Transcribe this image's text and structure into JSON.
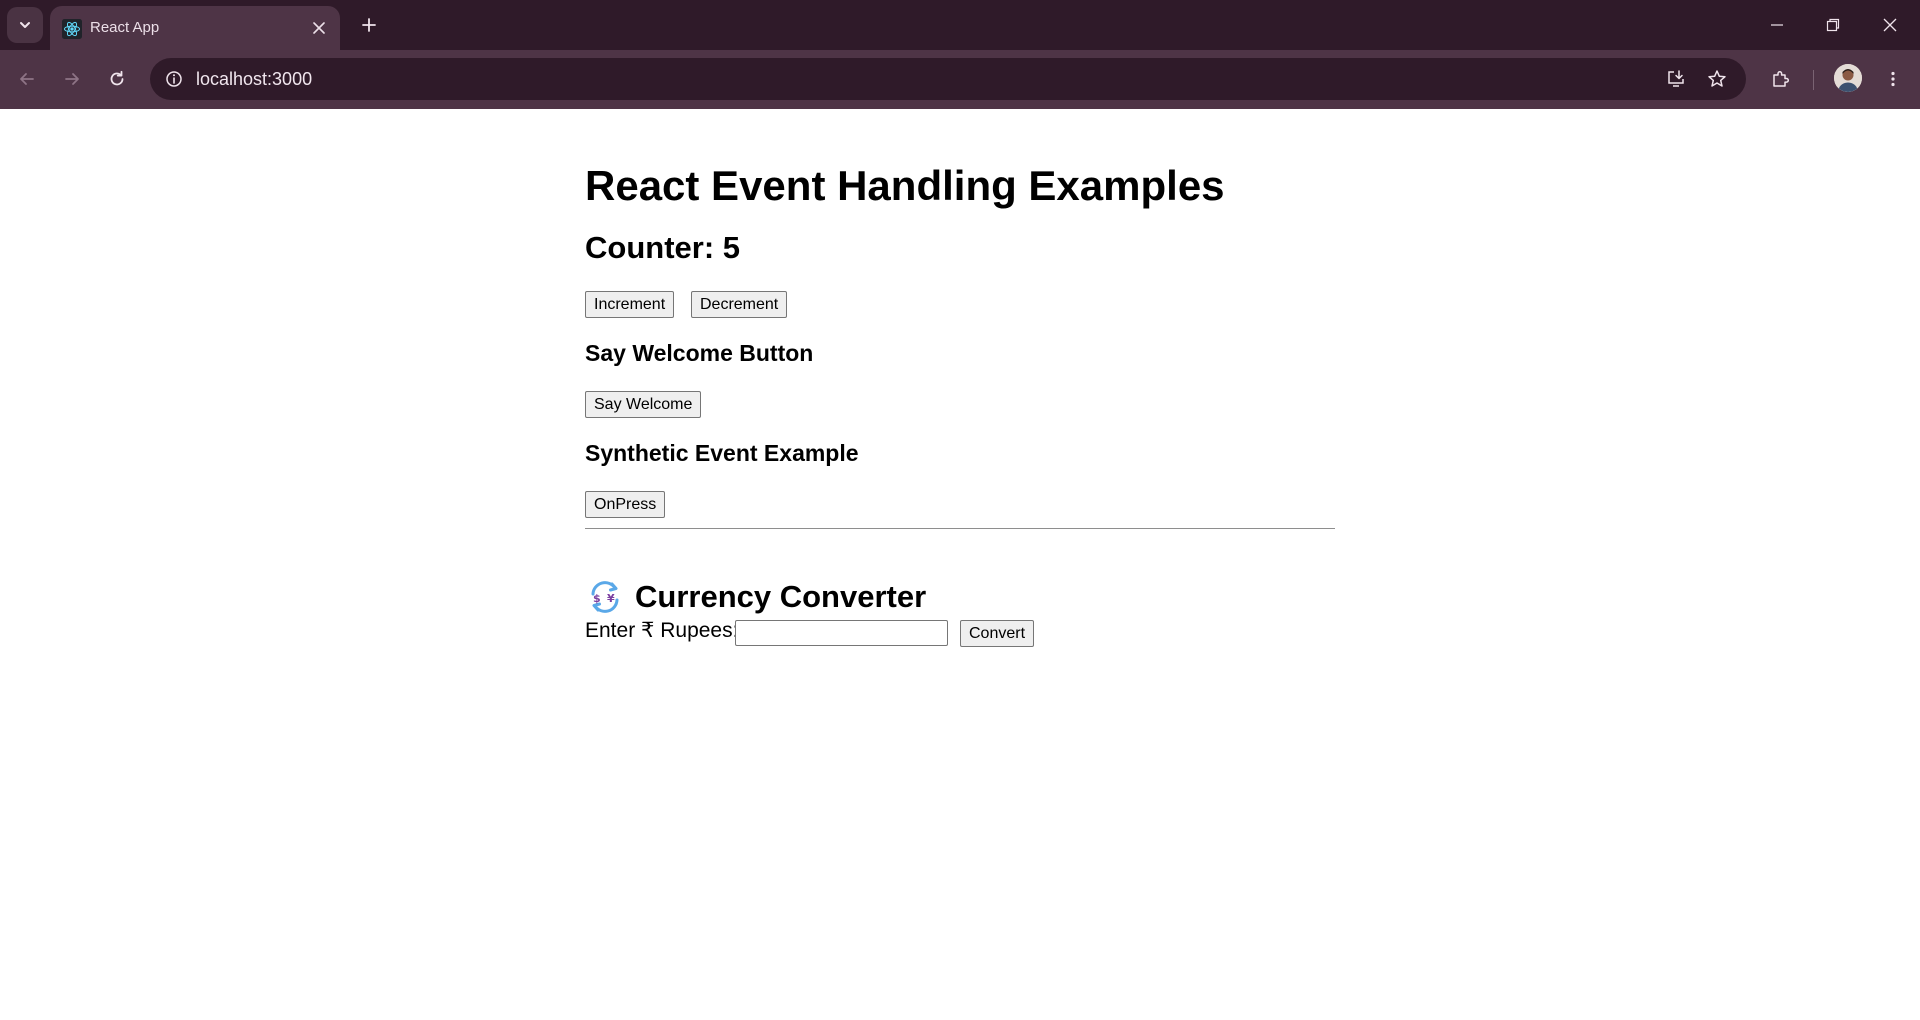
{
  "browser": {
    "tab_title": "React App",
    "url": "localhost:3000",
    "colors": {
      "tabbar_bg": "#2f1a29",
      "toolbar_bg": "#4e3446",
      "omnibox_bg": "#2f1a29"
    },
    "icons": {
      "tab_search": "chevron-down-icon",
      "favicon": "react-logo-icon",
      "tab_close": "close-icon",
      "new_tab": "plus-icon",
      "minimize": "minimize-icon",
      "restore": "restore-icon",
      "close_window": "close-icon",
      "back": "arrow-left-icon",
      "forward": "arrow-right-icon",
      "reload": "reload-icon",
      "site_info": "info-icon",
      "install": "install-app-icon",
      "bookmark": "star-icon",
      "extensions": "puzzle-icon",
      "profile": "avatar-icon",
      "menu": "kebab-menu-icon"
    }
  },
  "page": {
    "title": "React Event Handling Examples",
    "counter": {
      "label": "Counter: 5",
      "increment_label": "Increment",
      "decrement_label": "Decrement"
    },
    "welcome": {
      "heading": "Say Welcome Button",
      "button_label": "Say Welcome"
    },
    "synthetic": {
      "heading": "Synthetic Event Example",
      "button_label": "OnPress"
    },
    "converter": {
      "icon": "currency-exchange-icon",
      "title": "Currency Converter",
      "input_label": "Enter ₹ Rupees:",
      "input_value": "",
      "input_placeholder": "",
      "convert_label": "Convert"
    }
  }
}
